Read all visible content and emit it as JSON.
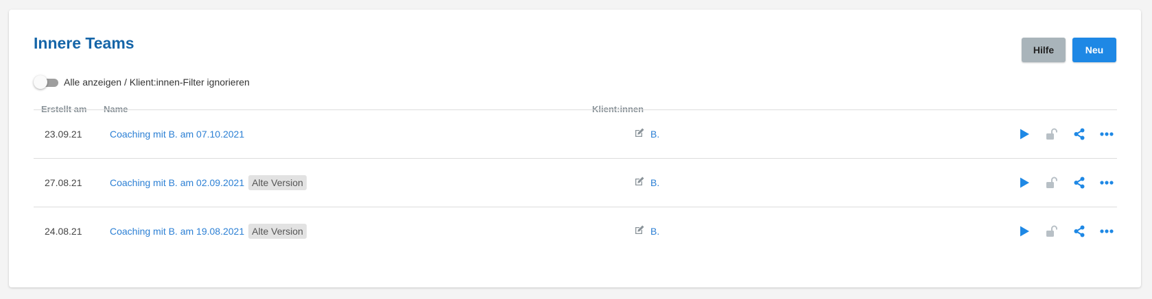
{
  "header": {
    "title": "Innere Teams",
    "help_label": "Hilfe",
    "new_label": "Neu"
  },
  "filter": {
    "toggle_label": "Alle anzeigen / Klient:innen-Filter ignorieren",
    "toggle_on": false
  },
  "table": {
    "columns": {
      "created": "Erstellt am",
      "name": "Name",
      "clients": "Klient:innen"
    },
    "rows": [
      {
        "created": "23.09.21",
        "name": "Coaching mit B. am 07.10.2021",
        "badge": "",
        "client": "B."
      },
      {
        "created": "27.08.21",
        "name": "Coaching mit B. am 02.09.2021",
        "badge": "Alte Version",
        "client": "B."
      },
      {
        "created": "24.08.21",
        "name": "Coaching mit B. am 19.08.2021",
        "badge": "Alte Version",
        "client": "B."
      }
    ]
  },
  "icons": {
    "edit": "edit-icon",
    "play": "play-icon",
    "lock": "lock-open-icon",
    "share": "share-icon",
    "more": "more-horizontal-icon"
  },
  "colors": {
    "accent": "#1e88e5",
    "title": "#1565a8",
    "link": "#2b7fd4",
    "muted_icon": "#b8c0c6"
  }
}
